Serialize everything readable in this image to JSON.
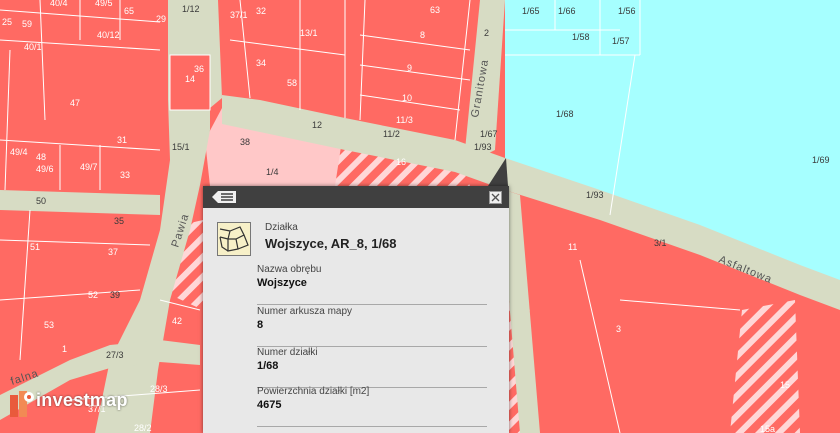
{
  "map": {
    "streets": [
      "Granitowa",
      "Pawia",
      "Asfaltowa",
      "falna"
    ],
    "labels": [
      {
        "id": "l1",
        "text": "25"
      },
      {
        "id": "l2",
        "text": "59"
      },
      {
        "id": "l3",
        "text": "40/4"
      },
      {
        "id": "l4",
        "text": "49/5"
      },
      {
        "id": "l5",
        "text": "65"
      },
      {
        "id": "l6",
        "text": "29"
      },
      {
        "id": "l7",
        "text": "1/12"
      },
      {
        "id": "l8",
        "text": "37/1"
      },
      {
        "id": "l9",
        "text": "32"
      },
      {
        "id": "l10",
        "text": "63"
      },
      {
        "id": "l11",
        "text": "40/1"
      },
      {
        "id": "l12",
        "text": "40/12"
      },
      {
        "id": "l13",
        "text": "13/1"
      },
      {
        "id": "l14",
        "text": "8"
      },
      {
        "id": "l15",
        "text": "36"
      },
      {
        "id": "l16",
        "text": "14"
      },
      {
        "id": "l17",
        "text": "34"
      },
      {
        "id": "l18",
        "text": "58"
      },
      {
        "id": "l19",
        "text": "9"
      },
      {
        "id": "l20",
        "text": "47"
      },
      {
        "id": "l21",
        "text": "10"
      },
      {
        "id": "l22",
        "text": "11/3"
      },
      {
        "id": "l23",
        "text": "12"
      },
      {
        "id": "l24",
        "text": "11/2"
      },
      {
        "id": "l25",
        "text": "38"
      },
      {
        "id": "l26",
        "text": "31"
      },
      {
        "id": "l27",
        "text": "15/1"
      },
      {
        "id": "l28",
        "text": "48"
      },
      {
        "id": "l29",
        "text": "49/4"
      },
      {
        "id": "l30",
        "text": "49/6"
      },
      {
        "id": "l31",
        "text": "49/7"
      },
      {
        "id": "l32",
        "text": "33"
      },
      {
        "id": "l33",
        "text": "1/4"
      },
      {
        "id": "l34",
        "text": "50"
      },
      {
        "id": "l35",
        "text": "35"
      },
      {
        "id": "l36",
        "text": "51"
      },
      {
        "id": "l37",
        "text": "37"
      },
      {
        "id": "l38",
        "text": "52"
      },
      {
        "id": "l39",
        "text": "39"
      },
      {
        "id": "l40",
        "text": "53"
      },
      {
        "id": "l41",
        "text": "42"
      },
      {
        "id": "l42",
        "text": "1"
      },
      {
        "id": "l43",
        "text": "27/3"
      },
      {
        "id": "l44",
        "text": "28/3"
      },
      {
        "id": "l45",
        "text": "28/2"
      },
      {
        "id": "l46",
        "text": "37/1"
      },
      {
        "id": "l47",
        "text": "1/65"
      },
      {
        "id": "l48",
        "text": "1/66"
      },
      {
        "id": "l49",
        "text": "1/56"
      },
      {
        "id": "l50",
        "text": "1/58"
      },
      {
        "id": "l51",
        "text": "1/57"
      },
      {
        "id": "l52",
        "text": "2"
      },
      {
        "id": "l53",
        "text": "1/68"
      },
      {
        "id": "l54",
        "text": "1/67"
      },
      {
        "id": "l55",
        "text": "1/93"
      },
      {
        "id": "l56",
        "text": "1/69"
      },
      {
        "id": "l57",
        "text": "1/93"
      },
      {
        "id": "l58",
        "text": "11"
      },
      {
        "id": "l59",
        "text": "3/1"
      },
      {
        "id": "l60",
        "text": "3"
      },
      {
        "id": "l61",
        "text": "15"
      },
      {
        "id": "l62",
        "text": "15a"
      },
      {
        "id": "l63",
        "text": "16"
      }
    ]
  },
  "popup": {
    "type_label": "Działka",
    "title": "Wojszyce, AR_8, 1/68",
    "fields": [
      {
        "label": "Nazwa obrębu",
        "value": "Wojszyce"
      },
      {
        "label": "Numer arkusza mapy",
        "value": "8"
      },
      {
        "label": "Numer działki",
        "value": "1/68"
      },
      {
        "label": "Powierzchnia działki [m2]",
        "value": "4675"
      }
    ]
  },
  "logo": {
    "text": "investmap"
  },
  "colors": {
    "parcel": "#ff6a63",
    "parcel_light": "#ffc8c8",
    "water_parcel": "#a6ffff",
    "road": "#d7dcc4",
    "popup_header": "#404040",
    "popup_body": "#e8e8e8"
  }
}
